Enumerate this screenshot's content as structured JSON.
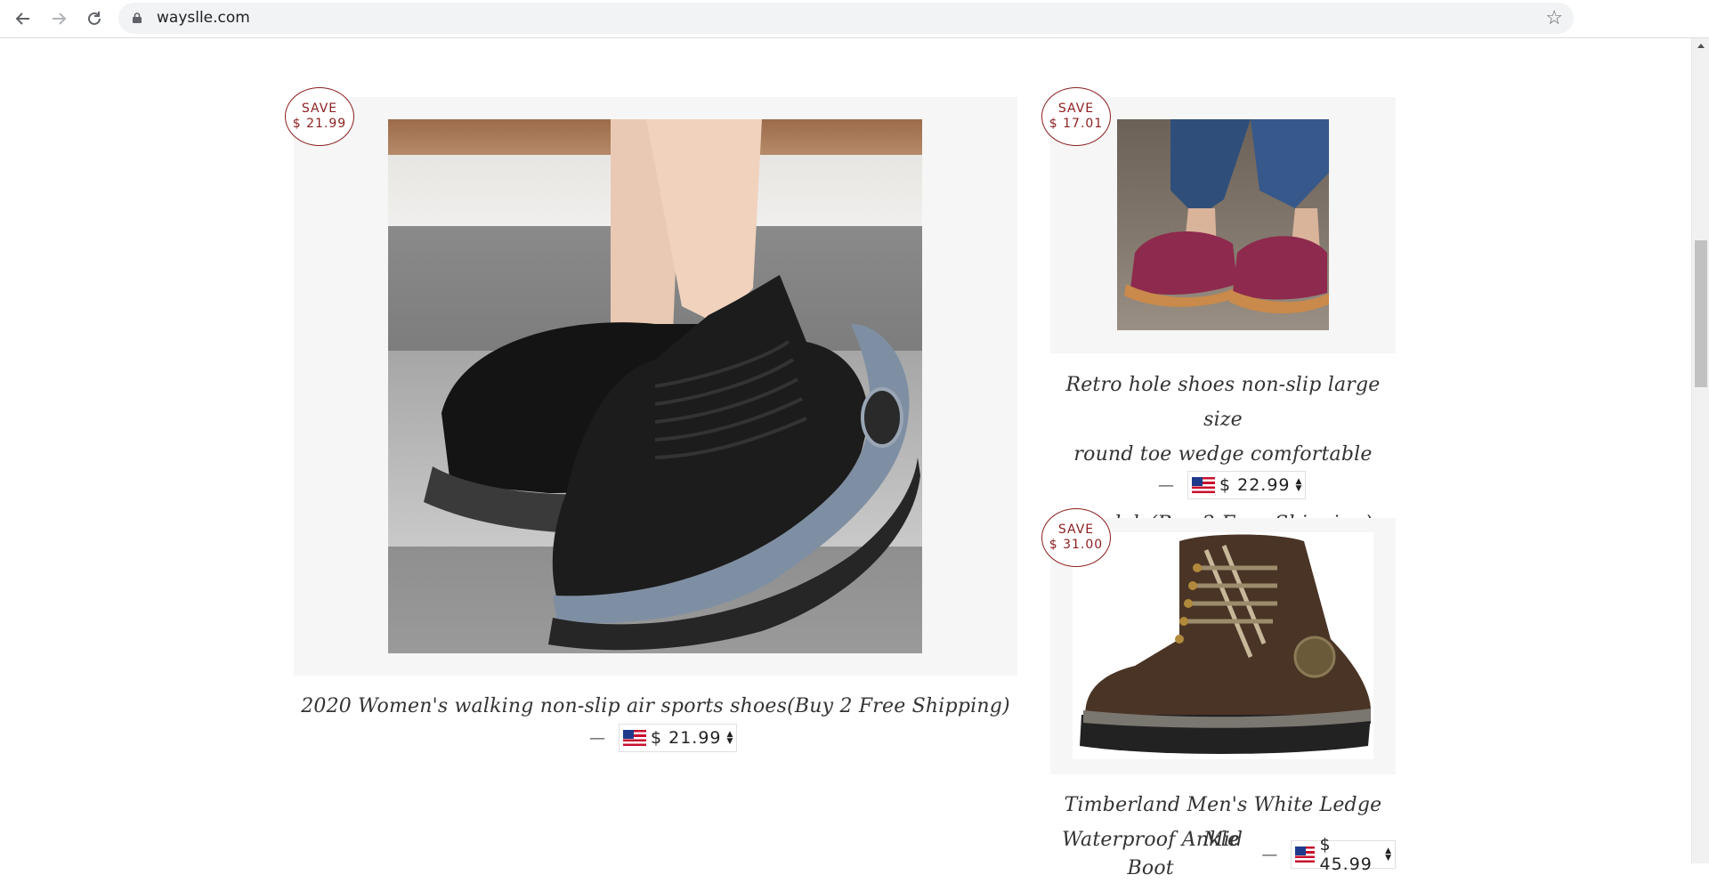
{
  "browser": {
    "url": "wayslle.com",
    "back_icon": "arrow-left-icon",
    "forward_icon": "arrow-right-icon",
    "reload_icon": "reload-icon",
    "lock_icon": "lock-icon",
    "bookmark_icon": "star-icon"
  },
  "products": [
    {
      "badge_line1": "SAVE",
      "badge_line2": "$ 21.99",
      "title": "2020 Women's walking non-slip air sports shoes(Buy 2 Free Shipping)",
      "dash": "—",
      "price": "$ 21.99"
    },
    {
      "badge_line1": "SAVE",
      "badge_line2": "$ 17.01",
      "title_lines": [
        "Retro hole shoes non-slip large size",
        "round toe wedge comfortable women",
        "sandals(Buy 2 Free Shipping)"
      ],
      "dash": "—",
      "price": "$ 22.99"
    },
    {
      "badge_line1": "SAVE",
      "badge_line2": "$ 31.00",
      "title_lines": [
        "Timberland Men's White Ledge Mid",
        "Waterproof Ankle Boot"
      ],
      "dash": "—",
      "price": "$ 45.99"
    }
  ],
  "colors": {
    "badge": "#8b1f1f",
    "card_bg": "#f6f6f6",
    "title_text": "#333333"
  }
}
